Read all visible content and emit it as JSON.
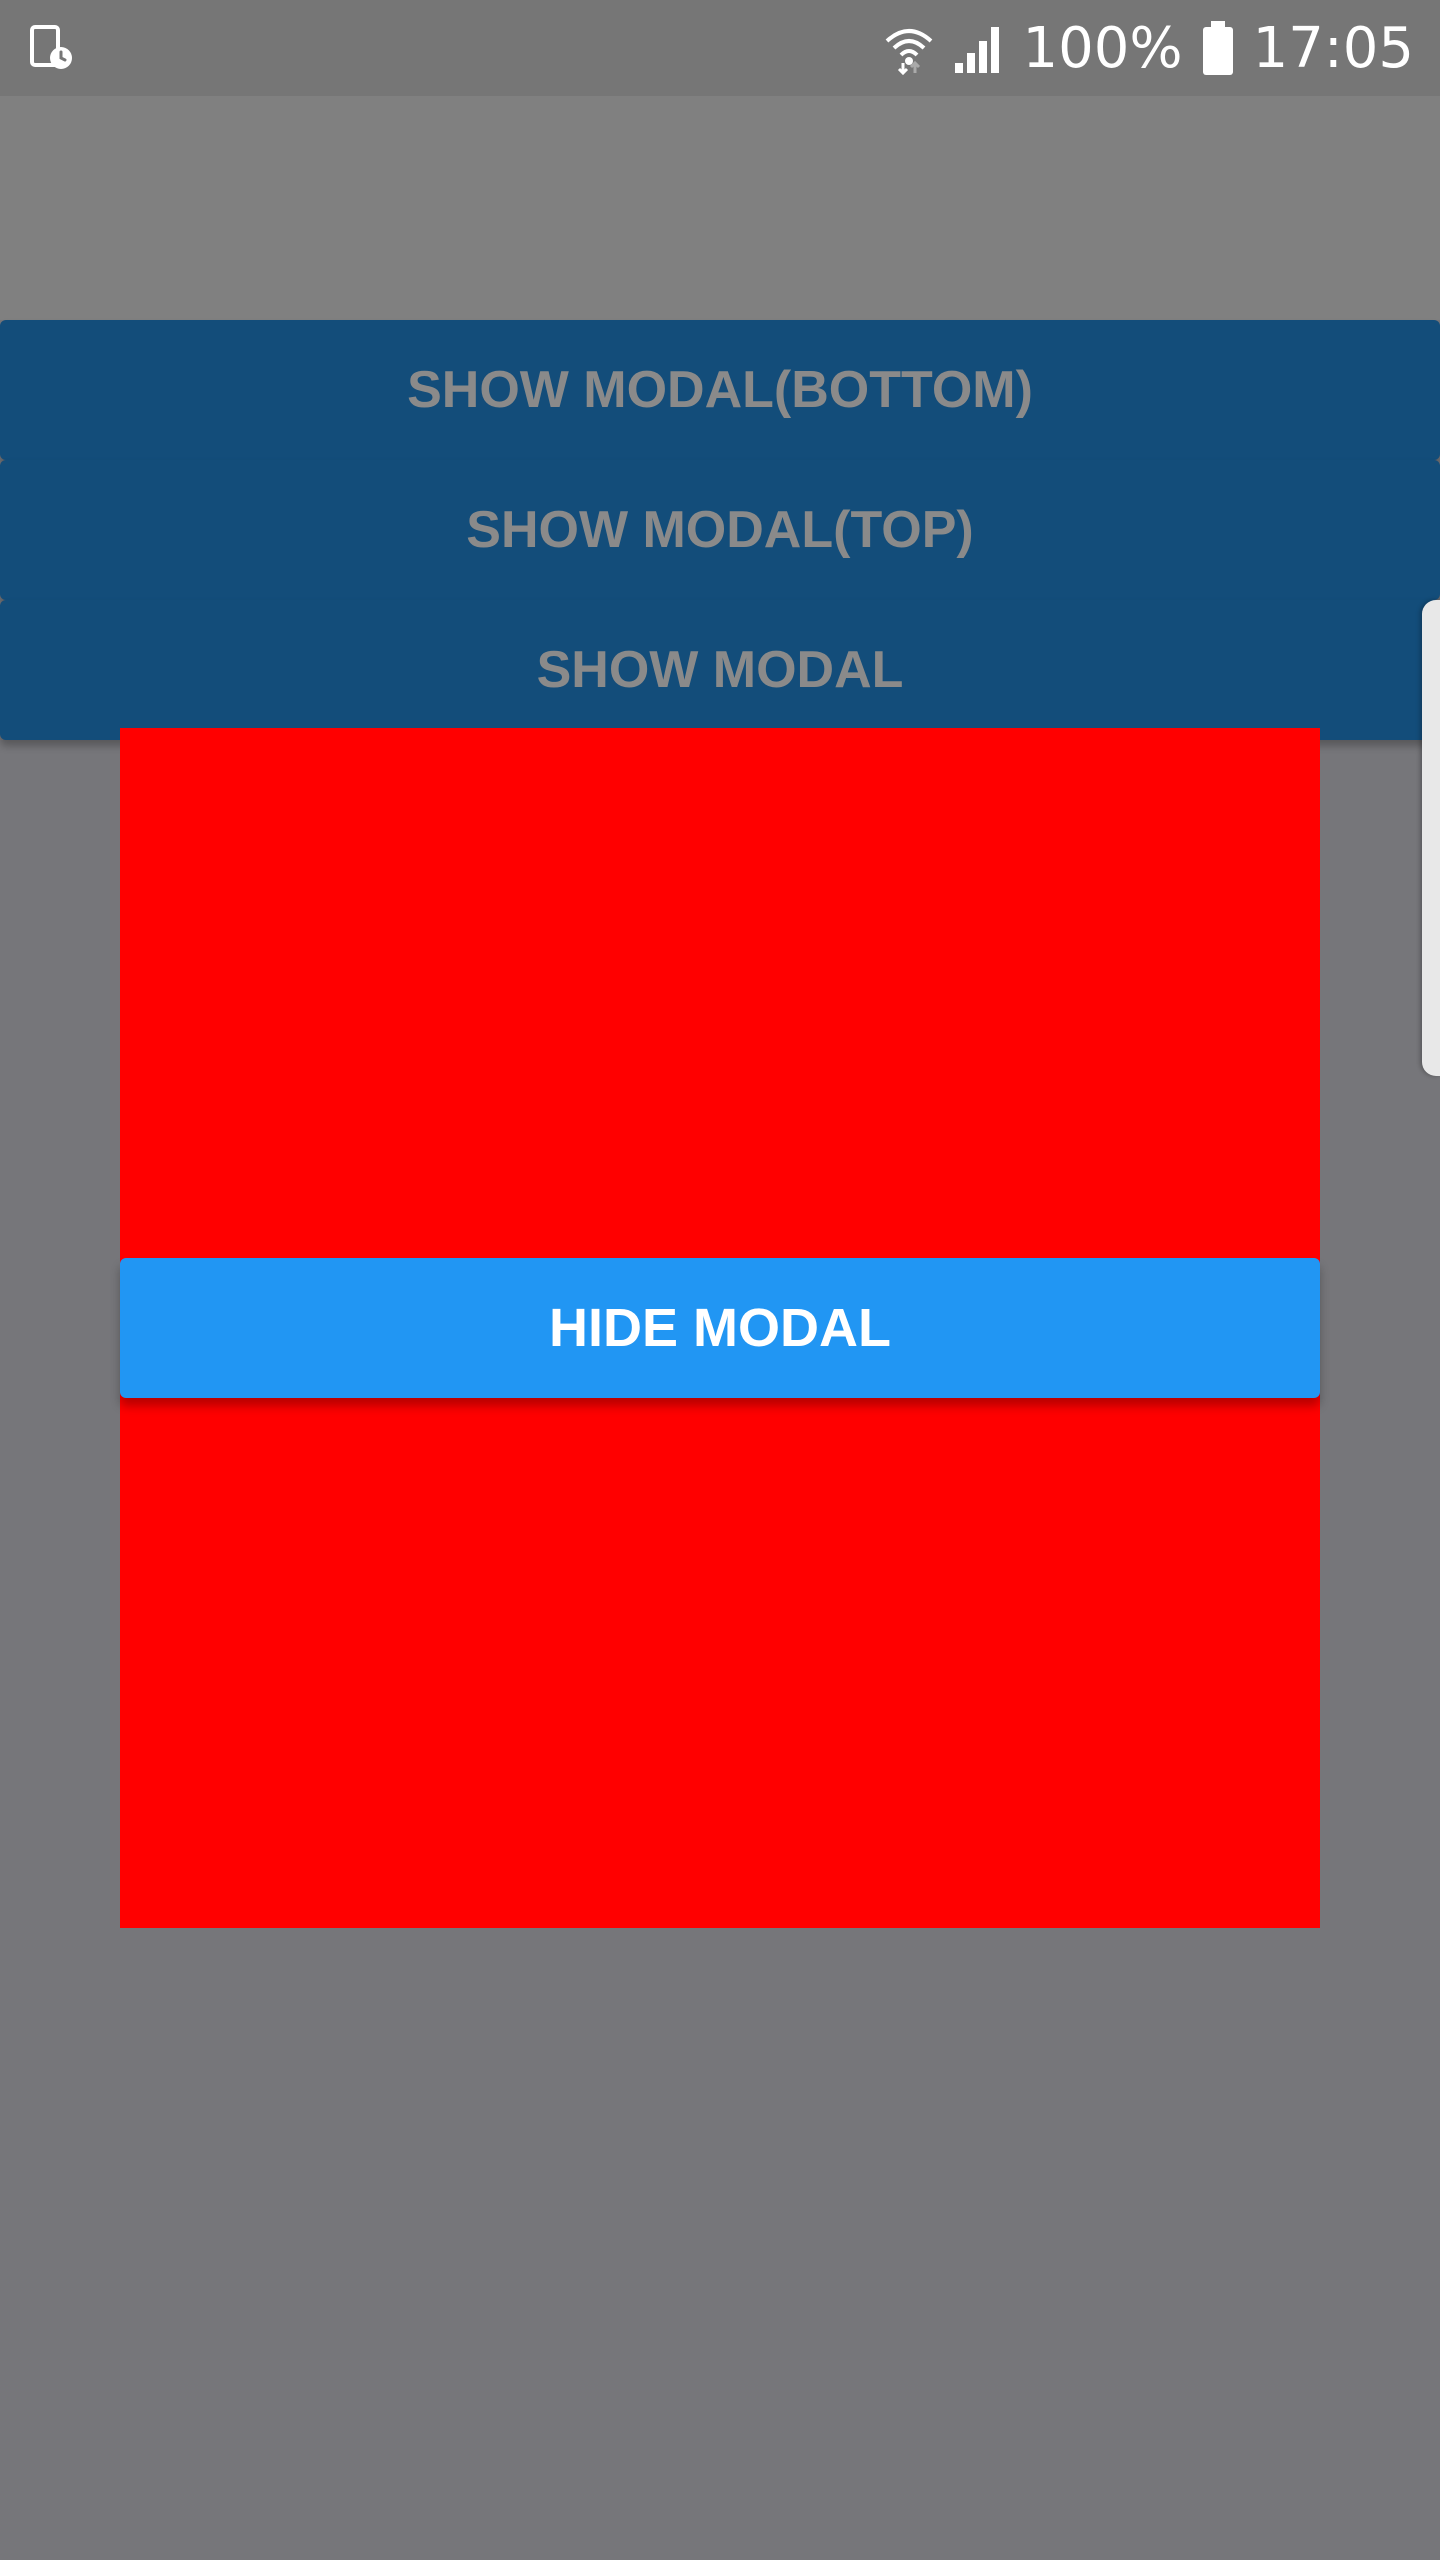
{
  "status_bar": {
    "left_icon": "screen-timer-icon",
    "wifi_icon": "wifi-icon",
    "signal_icon": "cell-signal-icon",
    "battery_percent": "100%",
    "battery_icon": "battery-full-icon",
    "time": "17:05"
  },
  "buttons": [
    {
      "label": "SHOW MODAL(BOTTOM)"
    },
    {
      "label": "SHOW MODAL(TOP)"
    },
    {
      "label": "SHOW MODAL"
    }
  ],
  "modal": {
    "hide_label": "HIDE MODAL"
  },
  "colors": {
    "backdrop": "#76767a",
    "button_bg": "#134d7a",
    "modal_bg": "#ff0000",
    "hide_button_bg": "#2196f3"
  }
}
